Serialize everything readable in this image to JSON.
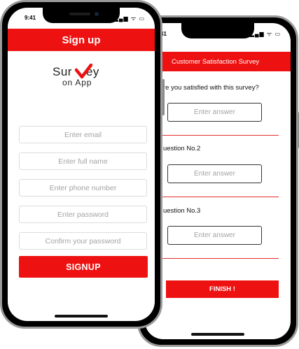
{
  "front": {
    "status": {
      "time": "9:41",
      "icons": "▂▄▆ ᯤ ▭"
    },
    "header": {
      "title": "Sign up"
    },
    "logo": {
      "word_part1": "Sur",
      "word_part2": "ey",
      "subtitle": "on App",
      "accent_color": "#ee1111"
    },
    "form": {
      "email_placeholder": "Enter email",
      "fullname_placeholder": "Enter full name",
      "phone_placeholder": "Enter phone number",
      "password_placeholder": "Enter password",
      "confirm_placeholder": "Confirm your password"
    },
    "signup_label": "SIGNUP"
  },
  "back": {
    "status": {
      "time": "41",
      "icons": "▂▄▆ ᯤ ▭"
    },
    "header": {
      "title": "Customer Satisfaction Survey"
    },
    "questions": [
      {
        "label": "re you satisfied with this survey?",
        "placeholder": "Enter answer"
      },
      {
        "label": "uestion No.2",
        "placeholder": "Enter answer"
      },
      {
        "label": "uestion No.3",
        "placeholder": "Enter answer"
      }
    ],
    "finish_label": "FINISH !"
  },
  "colors": {
    "accent": "#ee1111",
    "frame": "#9a9a9a"
  }
}
